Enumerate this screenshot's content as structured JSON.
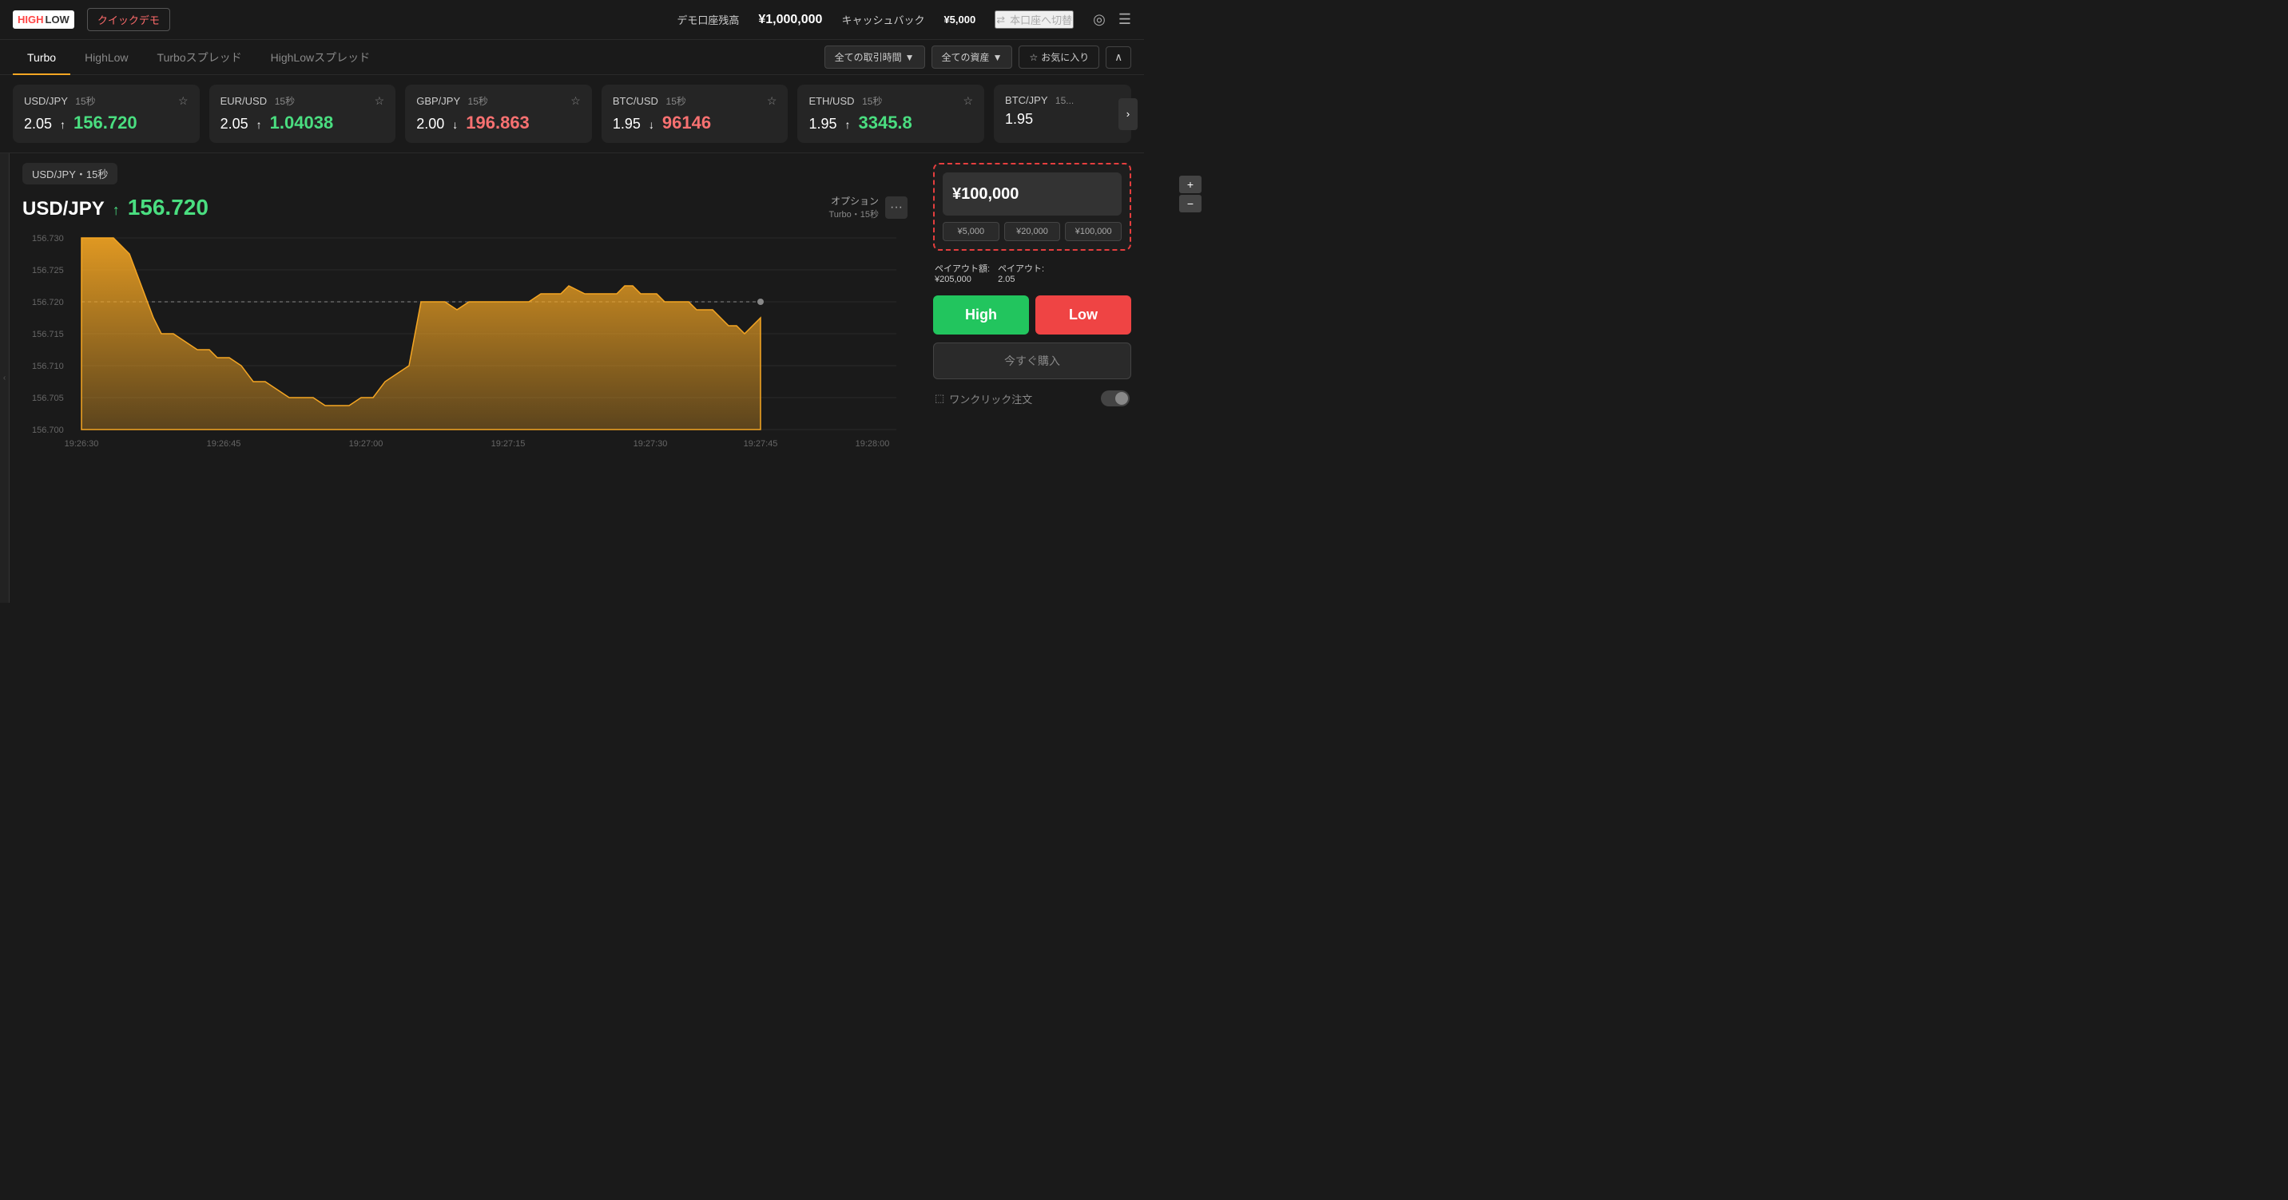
{
  "header": {
    "logo_high": "HIGH",
    "logo_low": "LOW",
    "quick_demo": "クイックデモ",
    "balance_label": "デモ口座残高",
    "balance_amount": "¥1,000,000",
    "cashback_label": "キャッシュバック",
    "cashback_amount": "¥5,000",
    "switch_label": "本口座へ切替"
  },
  "tabs": {
    "items": [
      {
        "label": "Turbo",
        "active": true
      },
      {
        "label": "HighLow",
        "active": false
      },
      {
        "label": "Turboスプレッド",
        "active": false
      },
      {
        "label": "HighLowスプレッド",
        "active": false
      }
    ],
    "filter_time": "全ての取引時間",
    "filter_asset": "全ての資産",
    "favorite": "お気に入り"
  },
  "asset_cards": [
    {
      "pair": "USD/JPY",
      "time": "15秒",
      "multiplier": "2.05",
      "price": "156.720",
      "direction": "up"
    },
    {
      "pair": "EUR/USD",
      "time": "15秒",
      "multiplier": "2.05",
      "price": "1.04038",
      "direction": "up"
    },
    {
      "pair": "GBP/JPY",
      "time": "15秒",
      "multiplier": "2.00",
      "price": "196.863",
      "direction": "down"
    },
    {
      "pair": "BTC/USD",
      "time": "15秒",
      "multiplier": "1.95",
      "price": "96146",
      "direction": "down"
    },
    {
      "pair": "ETH/USD",
      "time": "15秒",
      "multiplier": "1.95",
      "price": "3345.8",
      "direction": "up"
    },
    {
      "pair": "BTC/JPY",
      "time": "15",
      "multiplier": "1.95",
      "price": "",
      "direction": "up"
    }
  ],
  "breadcrumb": "USD/JPY・15秒",
  "chart": {
    "pair": "USD/JPY",
    "price": "156.720",
    "direction": "up",
    "option_label": "オプション",
    "option_detail": "Turbo・15秒",
    "y_labels": [
      "156.730",
      "156.725",
      "156.720",
      "156.715",
      "156.710",
      "156.705",
      "156.700"
    ],
    "x_labels": [
      "19:26:30",
      "19:26:45",
      "19:27:00",
      "19:27:15",
      "19:27:30",
      "19:27:45",
      "19:28:00"
    ]
  },
  "trading_panel": {
    "amount": "¥100,000",
    "preset1": "¥5,000",
    "preset2": "¥20,000",
    "preset3": "¥100,000",
    "payout_label": "ペイアウト額:",
    "payout_amount": "¥205,000",
    "payout_ratio_label": "ペイアウト:",
    "payout_ratio": "2.05",
    "high_label": "High",
    "low_label": "Low",
    "buy_now_label": "今すぐ購入",
    "one_click_label": "ワンクリック注文"
  }
}
